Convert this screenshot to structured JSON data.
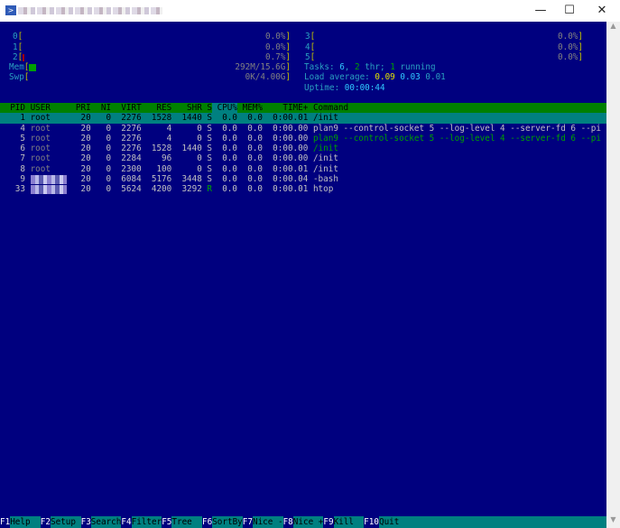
{
  "window": {
    "close": "✕",
    "maximize": "☐",
    "minimize": "—",
    "scroll_up": "▲",
    "scroll_down": "▼",
    "icon": "powershell-icon"
  },
  "meters": {
    "cpus": [
      {
        "id": "0",
        "value": "0.0%",
        "fill": 0.0
      },
      {
        "id": "1",
        "value": "0.0%",
        "fill": 0.0
      },
      {
        "id": "2",
        "value": "0.7%",
        "fill": 0.007
      },
      {
        "id": "3",
        "value": "0.0%",
        "fill": 0.0
      },
      {
        "id": "4",
        "value": "0.0%",
        "fill": 0.0
      },
      {
        "id": "5",
        "value": "0.0%",
        "fill": 0.0
      }
    ],
    "mem": {
      "label": "Mem",
      "value": "292M/15.6G"
    },
    "swp": {
      "label": "Swp",
      "value": "0K/4.00G"
    }
  },
  "stats": {
    "tasks_label": "Tasks: ",
    "tasks": "6",
    "sep1": ", ",
    "threads": "2",
    "thr_label": " thr; ",
    "running": "1",
    "running_label": " running",
    "load_label": "Load average: ",
    "load1": "0.09",
    "load5": "0.03",
    "load15": "0.01",
    "uptime_label": "Uptime: ",
    "uptime": "00:00:44"
  },
  "columns": [
    "PID",
    "USER",
    "PRI",
    "NI",
    "VIRT",
    "RES",
    "SHR",
    "S",
    "CPU%",
    "MEM%",
    "TIME+",
    "Command"
  ],
  "sort_column": "CPU%",
  "processes": [
    {
      "pid": "1",
      "user": "root",
      "pri": "20",
      "ni": "0",
      "virt": "2276",
      "res": "1528",
      "shr": "1440",
      "s": "S",
      "cpu": "0.0",
      "mem": "0.0",
      "time": "0:00.01",
      "command": "/init",
      "selected": true
    },
    {
      "pid": "4",
      "user": "root",
      "pri": "20",
      "ni": "0",
      "virt": "2276",
      "res": "4",
      "shr": "0",
      "s": "S",
      "cpu": "0.0",
      "mem": "0.0",
      "time": "0:00.00",
      "command": "plan9 --control-socket 5 --log-level 4 --server-fd 6 --pi"
    },
    {
      "pid": "5",
      "user": "root",
      "pri": "20",
      "ni": "0",
      "virt": "2276",
      "res": "4",
      "shr": "0",
      "s": "S",
      "cpu": "0.0",
      "mem": "0.0",
      "time": "0:00.00",
      "command": "plan9 --control-socket 5 --log-level 4 --server-fd 6 --pi",
      "thread": true
    },
    {
      "pid": "6",
      "user": "root",
      "pri": "20",
      "ni": "0",
      "virt": "2276",
      "res": "1528",
      "shr": "1440",
      "s": "S",
      "cpu": "0.0",
      "mem": "0.0",
      "time": "0:00.00",
      "command": "/init",
      "thread": true
    },
    {
      "pid": "7",
      "user": "root",
      "pri": "20",
      "ni": "0",
      "virt": "2284",
      "res": "96",
      "shr": "0",
      "s": "S",
      "cpu": "0.0",
      "mem": "0.0",
      "time": "0:00.00",
      "command": "/init"
    },
    {
      "pid": "8",
      "user": "root",
      "pri": "20",
      "ni": "0",
      "virt": "2300",
      "res": "100",
      "shr": "0",
      "s": "S",
      "cpu": "0.0",
      "mem": "0.0",
      "time": "0:00.01",
      "command": "/init"
    },
    {
      "pid": "9",
      "user": "",
      "pri": "20",
      "ni": "0",
      "virt": "6084",
      "res": "5176",
      "shr": "3448",
      "s": "S",
      "cpu": "0.0",
      "mem": "0.0",
      "time": "0:00.04",
      "command": "-bash"
    },
    {
      "pid": "33",
      "user": "",
      "pri": "20",
      "ni": "0",
      "virt": "5624",
      "res": "4200",
      "shr": "3292",
      "s": "R",
      "cpu": "0.0",
      "mem": "0.0",
      "time": "0:00.01",
      "command": "htop"
    }
  ],
  "footer": [
    {
      "key": "F1",
      "label": "Help  "
    },
    {
      "key": "F2",
      "label": "Setup "
    },
    {
      "key": "F3",
      "label": "Search"
    },
    {
      "key": "F4",
      "label": "Filter"
    },
    {
      "key": "F5",
      "label": "Tree  "
    },
    {
      "key": "F6",
      "label": "SortBy"
    },
    {
      "key": "F7",
      "label": "Nice -"
    },
    {
      "key": "F8",
      "label": "Nice +"
    },
    {
      "key": "F9",
      "label": "Kill  "
    },
    {
      "key": "F10",
      "label": "Quit"
    }
  ]
}
